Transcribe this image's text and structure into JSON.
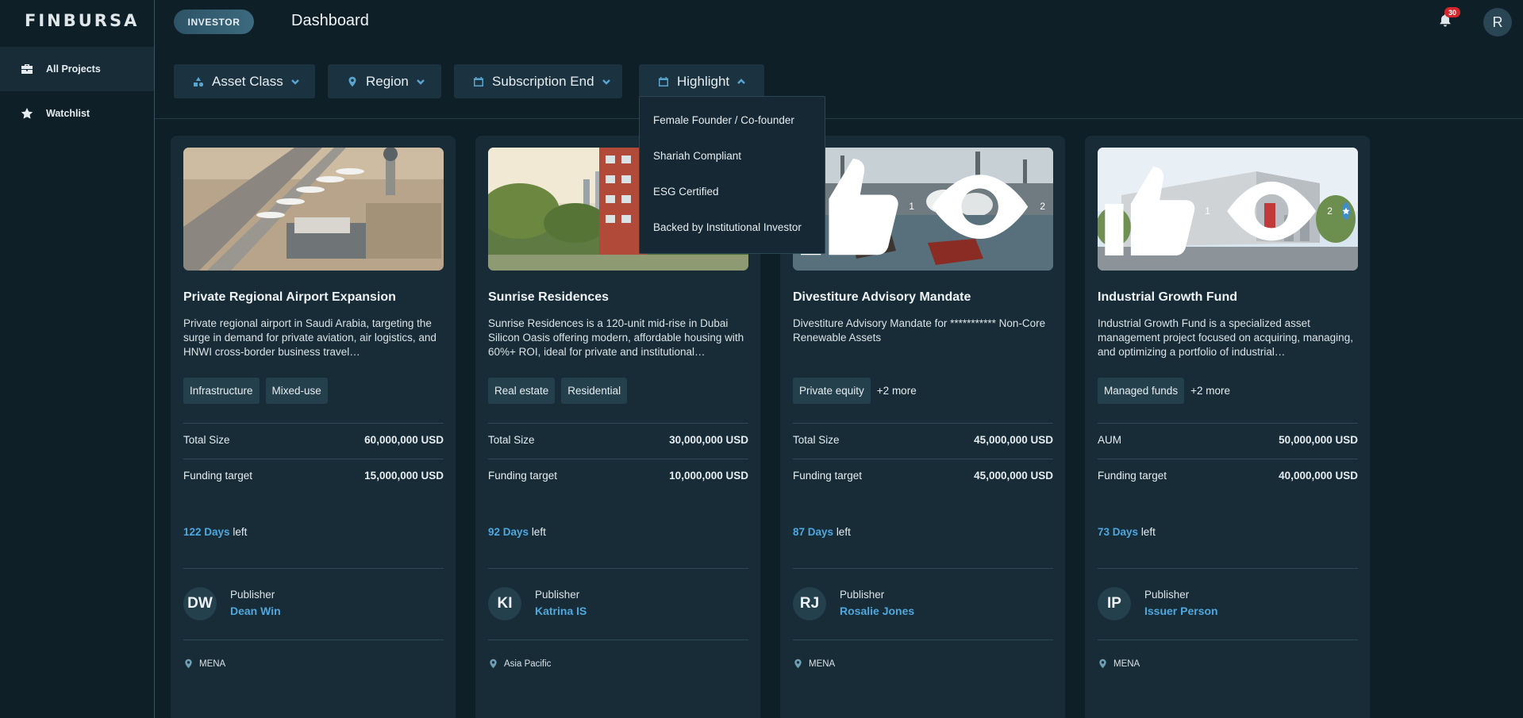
{
  "app": {
    "logo": "FINBURSA",
    "role": "INVESTOR",
    "page_title": "Dashboard",
    "notifications_count": "30",
    "user_initial": "R"
  },
  "sidebar": {
    "items": [
      {
        "label": "All Projects",
        "icon": "briefcase-icon",
        "active": true
      },
      {
        "label": "Watchlist",
        "icon": "star-icon",
        "active": false
      }
    ]
  },
  "filters": [
    {
      "label": "Asset Class",
      "icon": "shapes-icon"
    },
    {
      "label": "Region",
      "icon": "map-pin-icon"
    },
    {
      "label": "Subscription End",
      "icon": "calendar-icon"
    },
    {
      "label": "Highlight",
      "icon": "calendar-icon",
      "open": true
    }
  ],
  "highlight_menu": {
    "items": [
      "Female Founder / Co-founder",
      "Shariah Compliant",
      "ESG Certified",
      "Backed by Institutional Investor"
    ]
  },
  "labels": {
    "publisher": "Publisher",
    "left": "left"
  },
  "colors": {
    "background": "#0f1f28",
    "card": "#172c37",
    "accent": "#4fa7dd",
    "badge": "#d6262c"
  },
  "cards": [
    {
      "title": "Private Regional Airport Expansion",
      "description": "Private regional airport in Saudi Arabia, targeting the surge in demand for private aviation, air logistics, and HNWI cross-border business travel…",
      "tags": [
        "Infrastructure",
        "Mixed-use"
      ],
      "more": "",
      "size_label": "Total Size",
      "size_value": "60,000,000 USD",
      "target_label": "Funding target",
      "target_value": "15,000,000 USD",
      "days": "122 Days",
      "publisher_initials": "DW",
      "publisher_name": "Dean Win",
      "region": "MENA",
      "likes": "",
      "views": ""
    },
    {
      "title": "Sunrise Residences",
      "description": "Sunrise Residences is a 120-unit mid-rise in Dubai Silicon Oasis offering modern, affordable housing with 60%+ ROI, ideal for private and institutional…",
      "tags": [
        "Real estate",
        "Residential"
      ],
      "more": "",
      "size_label": "Total Size",
      "size_value": "30,000,000 USD",
      "target_label": "Funding target",
      "target_value": "10,000,000 USD",
      "days": "92 Days",
      "publisher_initials": "KI",
      "publisher_name": "Katrina IS",
      "region": "Asia Pacific",
      "likes": "",
      "views": ""
    },
    {
      "title": "Divestiture Advisory Mandate",
      "description": "Divestiture Advisory Mandate for *********** Non-Core Renewable Assets",
      "tags": [
        "Private equity"
      ],
      "more": "+2 more",
      "size_label": "Total Size",
      "size_value": "45,000,000 USD",
      "target_label": "Funding target",
      "target_value": "45,000,000 USD",
      "days": "87 Days",
      "publisher_initials": "RJ",
      "publisher_name": "Rosalie Jones",
      "region": "MENA",
      "likes": "1",
      "views": "2"
    },
    {
      "title": "Industrial Growth Fund",
      "description": "Industrial Growth Fund is a specialized asset management project focused on acquiring, managing, and optimizing a portfolio of industrial…",
      "tags": [
        "Managed funds"
      ],
      "more": "+2 more",
      "size_label": "AUM",
      "size_value": "50,000,000 USD",
      "target_label": "Funding target",
      "target_value": "40,000,000 USD",
      "days": "73 Days",
      "publisher_initials": "IP",
      "publisher_name": "Issuer Person",
      "region": "MENA",
      "likes": "1",
      "views": "2",
      "watchlisted": true
    }
  ]
}
